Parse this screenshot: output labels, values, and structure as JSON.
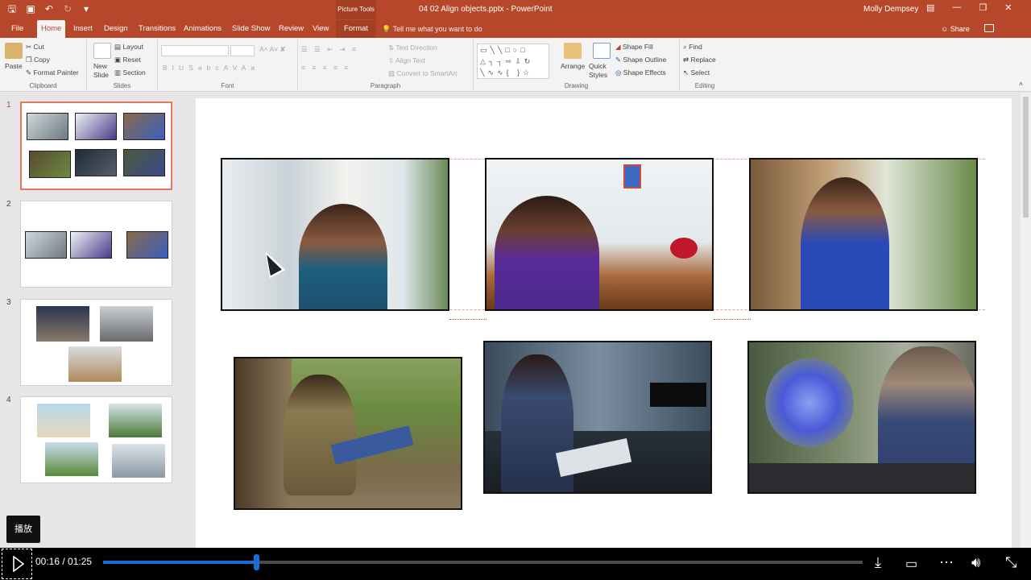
{
  "titlebar": {
    "qat_icons": [
      "save-icon",
      "present-icon",
      "undo-icon",
      "redo-icon",
      "customize-icon"
    ],
    "context_label": "Picture Tools",
    "document_title": "04 02 Align objects.pptx  -  PowerPoint",
    "user": "Molly Dempsey"
  },
  "tabs": [
    {
      "label": "File"
    },
    {
      "label": "Home"
    },
    {
      "label": "Insert"
    },
    {
      "label": "Design"
    },
    {
      "label": "Transitions"
    },
    {
      "label": "Animations"
    },
    {
      "label": "Slide Show"
    },
    {
      "label": "Review"
    },
    {
      "label": "View"
    },
    {
      "label": "Format"
    }
  ],
  "tell_me": "Tell me what you want to do",
  "share": "Share",
  "ribbon": {
    "clipboard": {
      "paste": "Paste",
      "cut": "Cut",
      "copy": "Copy",
      "format_painter": "Format Painter",
      "label": "Clipboard"
    },
    "slides": {
      "new_slide": "New Slide",
      "layout": "Layout",
      "reset": "Reset",
      "section": "Section",
      "label": "Slides"
    },
    "font": {
      "bold": "B",
      "italic": "I",
      "underline": "U",
      "strike": "S",
      "shadow": "abc",
      "spacing": "AV",
      "case": "Aa",
      "label": "Font"
    },
    "paragraph": {
      "text_direction": "Text Direction",
      "align_text": "Align Text",
      "convert_smartart": "Convert to SmartArt",
      "label": "Paragraph"
    },
    "drawing": {
      "arrange": "Arrange",
      "quick_styles": "Quick Styles",
      "shape_fill": "Shape Fill",
      "shape_outline": "Shape Outline",
      "shape_effects": "Shape Effects",
      "label": "Drawing"
    },
    "editing": {
      "find": "Find",
      "replace": "Replace",
      "select": "Select",
      "label": "Editing"
    }
  },
  "slides": [
    {
      "number": "1"
    },
    {
      "number": "2"
    },
    {
      "number": "3"
    },
    {
      "number": "4"
    }
  ],
  "tooltip": "播放",
  "player": {
    "current_time": "00:16",
    "separator": " / ",
    "total_time": "01:25",
    "progress": 0.201
  },
  "colors": {
    "accent": "#b7472a",
    "progress": "#1a6fd6"
  }
}
